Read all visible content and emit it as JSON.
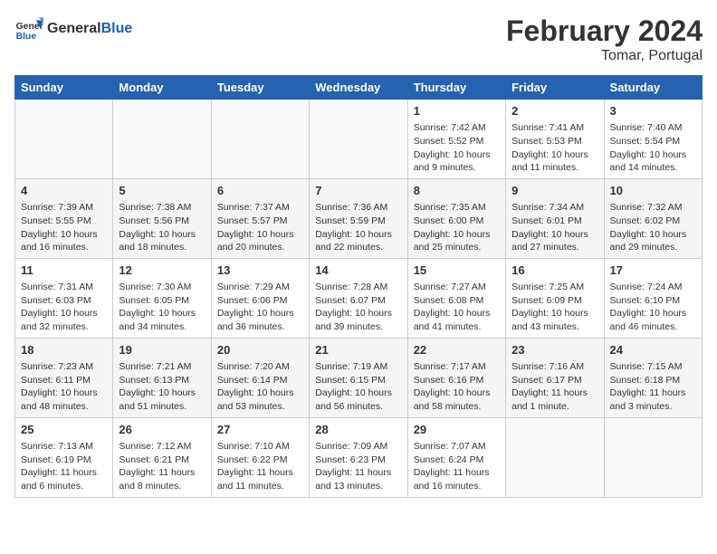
{
  "header": {
    "logo_line1": "General",
    "logo_line2": "Blue",
    "month": "February 2024",
    "location": "Tomar, Portugal"
  },
  "days_of_week": [
    "Sunday",
    "Monday",
    "Tuesday",
    "Wednesday",
    "Thursday",
    "Friday",
    "Saturday"
  ],
  "weeks": [
    [
      {
        "day": "",
        "info": ""
      },
      {
        "day": "",
        "info": ""
      },
      {
        "day": "",
        "info": ""
      },
      {
        "day": "",
        "info": ""
      },
      {
        "day": "1",
        "info": "Sunrise: 7:42 AM\nSunset: 5:52 PM\nDaylight: 10 hours and 9 minutes."
      },
      {
        "day": "2",
        "info": "Sunrise: 7:41 AM\nSunset: 5:53 PM\nDaylight: 10 hours and 11 minutes."
      },
      {
        "day": "3",
        "info": "Sunrise: 7:40 AM\nSunset: 5:54 PM\nDaylight: 10 hours and 14 minutes."
      }
    ],
    [
      {
        "day": "4",
        "info": "Sunrise: 7:39 AM\nSunset: 5:55 PM\nDaylight: 10 hours and 16 minutes."
      },
      {
        "day": "5",
        "info": "Sunrise: 7:38 AM\nSunset: 5:56 PM\nDaylight: 10 hours and 18 minutes."
      },
      {
        "day": "6",
        "info": "Sunrise: 7:37 AM\nSunset: 5:57 PM\nDaylight: 10 hours and 20 minutes."
      },
      {
        "day": "7",
        "info": "Sunrise: 7:36 AM\nSunset: 5:59 PM\nDaylight: 10 hours and 22 minutes."
      },
      {
        "day": "8",
        "info": "Sunrise: 7:35 AM\nSunset: 6:00 PM\nDaylight: 10 hours and 25 minutes."
      },
      {
        "day": "9",
        "info": "Sunrise: 7:34 AM\nSunset: 6:01 PM\nDaylight: 10 hours and 27 minutes."
      },
      {
        "day": "10",
        "info": "Sunrise: 7:32 AM\nSunset: 6:02 PM\nDaylight: 10 hours and 29 minutes."
      }
    ],
    [
      {
        "day": "11",
        "info": "Sunrise: 7:31 AM\nSunset: 6:03 PM\nDaylight: 10 hours and 32 minutes."
      },
      {
        "day": "12",
        "info": "Sunrise: 7:30 AM\nSunset: 6:05 PM\nDaylight: 10 hours and 34 minutes."
      },
      {
        "day": "13",
        "info": "Sunrise: 7:29 AM\nSunset: 6:06 PM\nDaylight: 10 hours and 36 minutes."
      },
      {
        "day": "14",
        "info": "Sunrise: 7:28 AM\nSunset: 6:07 PM\nDaylight: 10 hours and 39 minutes."
      },
      {
        "day": "15",
        "info": "Sunrise: 7:27 AM\nSunset: 6:08 PM\nDaylight: 10 hours and 41 minutes."
      },
      {
        "day": "16",
        "info": "Sunrise: 7:25 AM\nSunset: 6:09 PM\nDaylight: 10 hours and 43 minutes."
      },
      {
        "day": "17",
        "info": "Sunrise: 7:24 AM\nSunset: 6:10 PM\nDaylight: 10 hours and 46 minutes."
      }
    ],
    [
      {
        "day": "18",
        "info": "Sunrise: 7:23 AM\nSunset: 6:11 PM\nDaylight: 10 hours and 48 minutes."
      },
      {
        "day": "19",
        "info": "Sunrise: 7:21 AM\nSunset: 6:13 PM\nDaylight: 10 hours and 51 minutes."
      },
      {
        "day": "20",
        "info": "Sunrise: 7:20 AM\nSunset: 6:14 PM\nDaylight: 10 hours and 53 minutes."
      },
      {
        "day": "21",
        "info": "Sunrise: 7:19 AM\nSunset: 6:15 PM\nDaylight: 10 hours and 56 minutes."
      },
      {
        "day": "22",
        "info": "Sunrise: 7:17 AM\nSunset: 6:16 PM\nDaylight: 10 hours and 58 minutes."
      },
      {
        "day": "23",
        "info": "Sunrise: 7:16 AM\nSunset: 6:17 PM\nDaylight: 11 hours and 1 minute."
      },
      {
        "day": "24",
        "info": "Sunrise: 7:15 AM\nSunset: 6:18 PM\nDaylight: 11 hours and 3 minutes."
      }
    ],
    [
      {
        "day": "25",
        "info": "Sunrise: 7:13 AM\nSunset: 6:19 PM\nDaylight: 11 hours and 6 minutes."
      },
      {
        "day": "26",
        "info": "Sunrise: 7:12 AM\nSunset: 6:21 PM\nDaylight: 11 hours and 8 minutes."
      },
      {
        "day": "27",
        "info": "Sunrise: 7:10 AM\nSunset: 6:22 PM\nDaylight: 11 hours and 11 minutes."
      },
      {
        "day": "28",
        "info": "Sunrise: 7:09 AM\nSunset: 6:23 PM\nDaylight: 11 hours and 13 minutes."
      },
      {
        "day": "29",
        "info": "Sunrise: 7:07 AM\nSunset: 6:24 PM\nDaylight: 11 hours and 16 minutes."
      },
      {
        "day": "",
        "info": ""
      },
      {
        "day": "",
        "info": ""
      }
    ]
  ]
}
